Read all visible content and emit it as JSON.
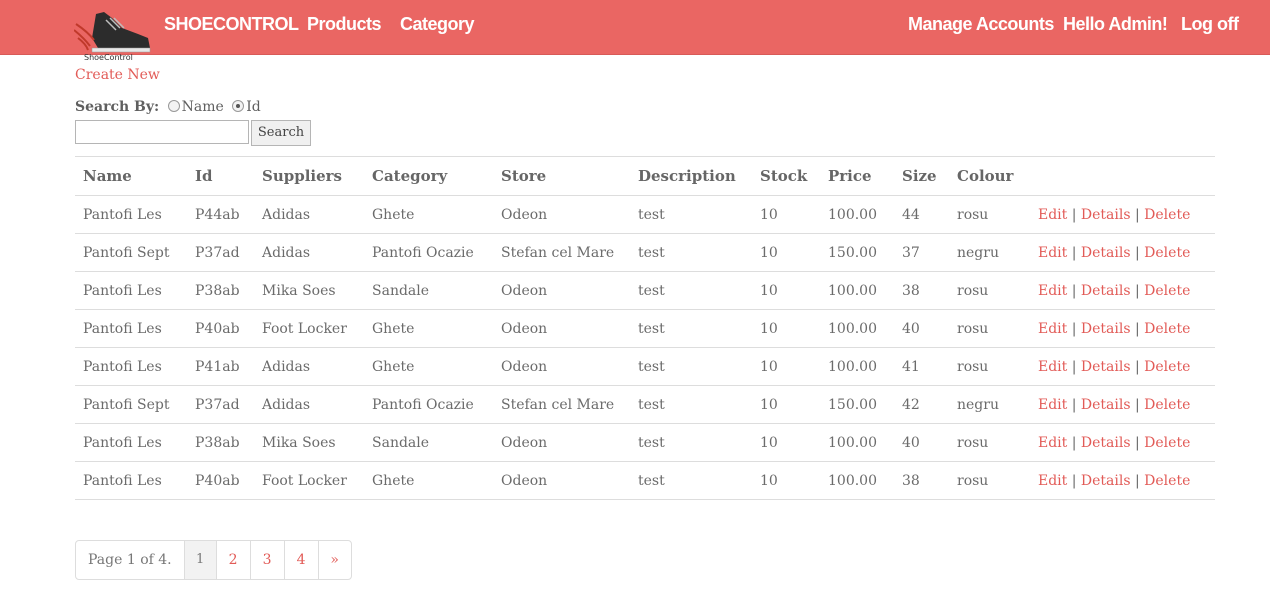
{
  "navbar": {
    "logo_caption": "ShoeControl",
    "brand": "SHOECONTROL",
    "links": [
      "Products",
      "Category"
    ],
    "right_links": [
      "Manage Accounts",
      "Hello Admin!",
      "Log off"
    ],
    "colors": {
      "navbar_bg": "#ea6663",
      "link_accent": "#e25b57"
    }
  },
  "actions": {
    "create_new": "Create New"
  },
  "search": {
    "label": "Search By:",
    "options": [
      "Name",
      "Id"
    ],
    "selected": "Id",
    "input_value": "",
    "button_label": "Search"
  },
  "table": {
    "headers": [
      "Name",
      "Id",
      "Suppliers",
      "Category",
      "Store",
      "Description",
      "Stock",
      "Price",
      "Size",
      "Colour"
    ],
    "action_labels": [
      "Edit",
      "Details",
      "Delete"
    ],
    "rows": [
      [
        "Pantofi Les",
        "P44ab",
        "Adidas",
        "Ghete",
        "Odeon",
        "test",
        "10",
        "100.00",
        "44",
        "rosu"
      ],
      [
        "Pantofi Sept",
        "P37ad",
        "Adidas",
        "Pantofi Ocazie",
        "Stefan cel Mare",
        "test",
        "10",
        "150.00",
        "37",
        "negru"
      ],
      [
        "Pantofi Les",
        "P38ab",
        "Mika Soes",
        "Sandale",
        "Odeon",
        "test",
        "10",
        "100.00",
        "38",
        "rosu"
      ],
      [
        "Pantofi Les",
        "P40ab",
        "Foot Locker",
        "Ghete",
        "Odeon",
        "test",
        "10",
        "100.00",
        "40",
        "rosu"
      ],
      [
        "Pantofi Les",
        "P41ab",
        "Adidas",
        "Ghete",
        "Odeon",
        "test",
        "10",
        "100.00",
        "41",
        "rosu"
      ],
      [
        "Pantofi Sept",
        "P37ad",
        "Adidas",
        "Pantofi Ocazie",
        "Stefan cel Mare",
        "test",
        "10",
        "150.00",
        "42",
        "negru"
      ],
      [
        "Pantofi Les",
        "P38ab",
        "Mika Soes",
        "Sandale",
        "Odeon",
        "test",
        "10",
        "100.00",
        "40",
        "rosu"
      ],
      [
        "Pantofi Les",
        "P40ab",
        "Foot Locker",
        "Ghete",
        "Odeon",
        "test",
        "10",
        "100.00",
        "38",
        "rosu"
      ]
    ]
  },
  "pagination": {
    "summary": "Page 1 of 4.",
    "pages": [
      "1",
      "2",
      "3",
      "4"
    ],
    "current": "1",
    "next": "»"
  }
}
